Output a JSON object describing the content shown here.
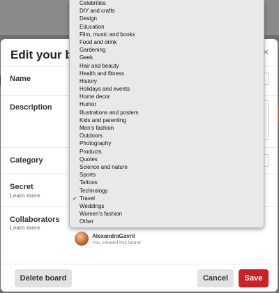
{
  "modal": {
    "title": "Edit your board",
    "close_icon": "×"
  },
  "fields": {
    "name_label": "Name",
    "description_label": "Description",
    "category_label": "Category",
    "secret_label": "Secret",
    "secret_learn_more": "Learn more",
    "collaborators_label": "Collaborators",
    "collaborators_learn_more": "Learn more"
  },
  "owner": {
    "name": "AlexandraGavril",
    "subtitle": "You created this board"
  },
  "buttons": {
    "delete": "Delete board",
    "cancel": "Cancel",
    "save": "Save"
  },
  "category_dropdown": {
    "selected": "Travel",
    "check_mark": "✓",
    "options": [
      "Celebrities",
      "DIY and crafts",
      "Design",
      "Education",
      "Film, music and books",
      "Food and drink",
      "Gardening",
      "Geek",
      "Hair and beauty",
      "Health and fitness",
      "History",
      "Holidays and events",
      "Home decor",
      "Humor",
      "Illustrations and posters",
      "Kids and parenting",
      "Men's fashion",
      "Outdoors",
      "Photography",
      "Products",
      "Quotes",
      "Science and nature",
      "Sports",
      "Tattoos",
      "Technology",
      "Travel",
      "Weddings",
      "Women's fashion",
      "Other"
    ]
  },
  "colors": {
    "save_button": "#cc2127",
    "dropdown_bg": "#e9e9e9"
  }
}
